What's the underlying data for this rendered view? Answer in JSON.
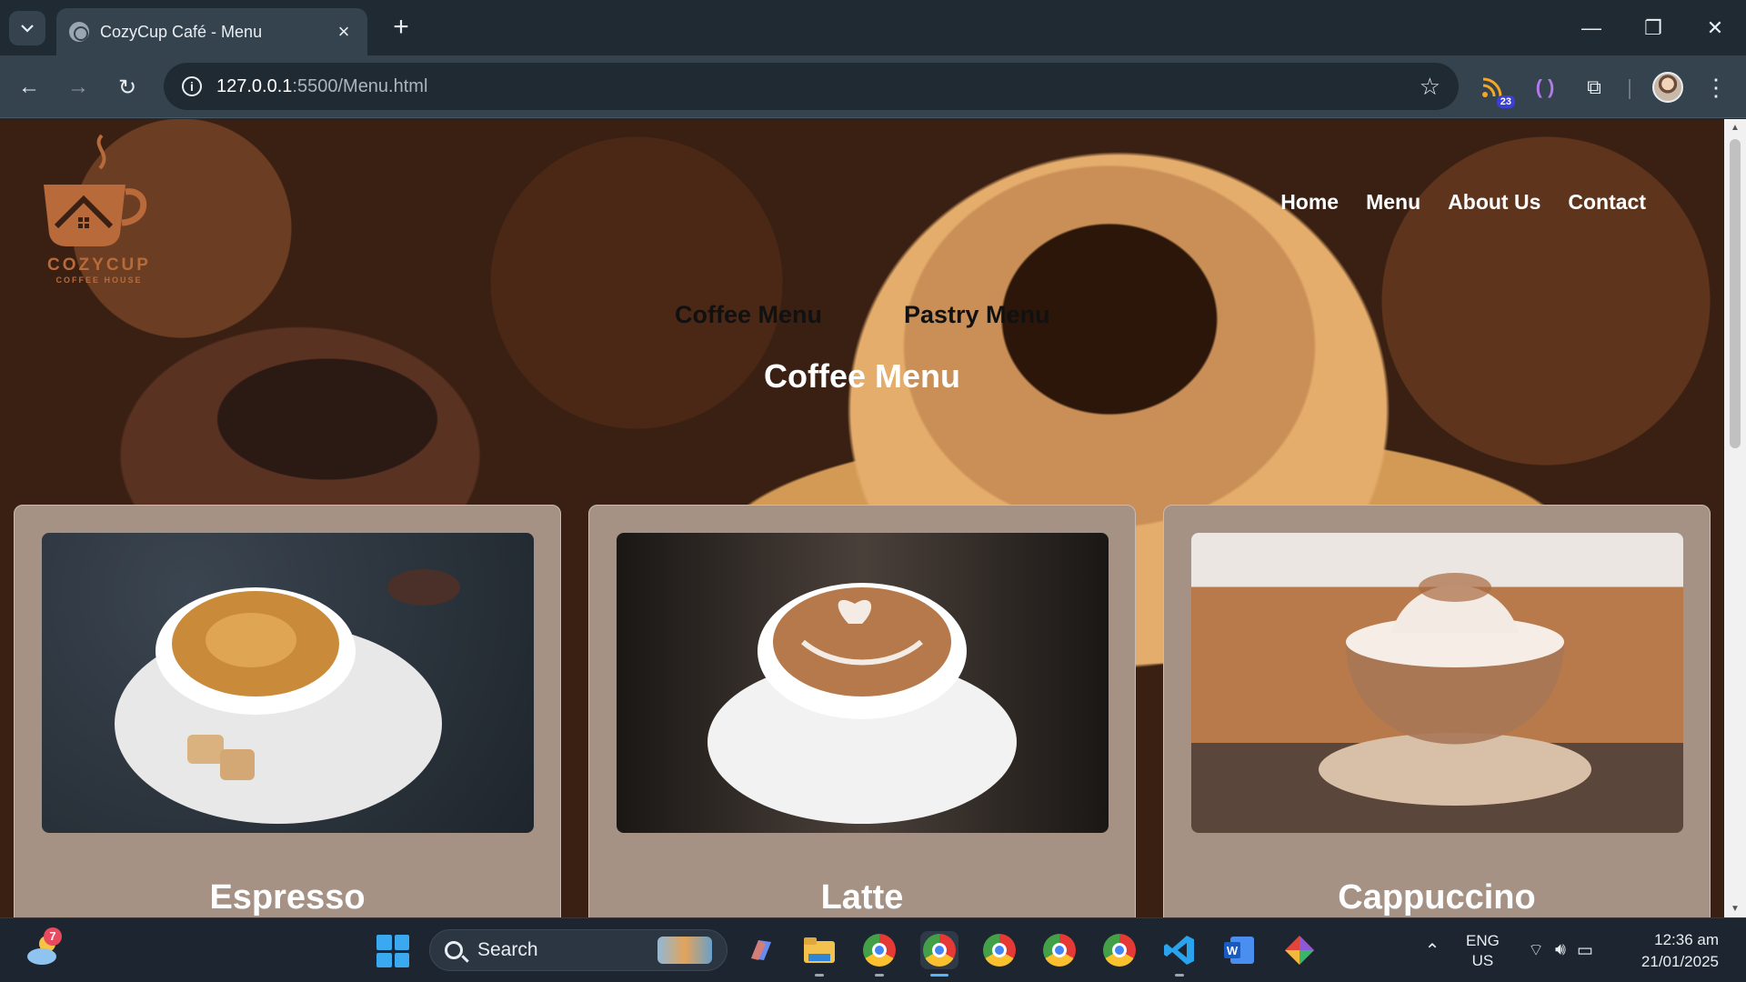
{
  "browser": {
    "tab_title": "CozyCup Café - Menu",
    "url_host": "127.0.0.1",
    "url_path": ":5500/Menu.html",
    "extension_badge": "23"
  },
  "site": {
    "logo_name": "COZYCUP",
    "logo_tagline": "COFFEE HOUSE",
    "nav": [
      "Home",
      "Menu",
      "About Us",
      "Contact"
    ],
    "menu_tabs": [
      "Coffee Menu",
      "Pastry Menu"
    ],
    "section_title": "Coffee Menu",
    "items": [
      {
        "name": "Espresso"
      },
      {
        "name": "Latte"
      },
      {
        "name": "Cappuccino"
      }
    ]
  },
  "taskbar": {
    "weather_badge": "7",
    "search_label": "Search",
    "language": "ENG",
    "region": "US",
    "time": "12:36 am",
    "date": "21/01/2025"
  },
  "colors": {
    "card_bg": "#a59285",
    "chrome_dark": "#1f2a33",
    "chrome_mid": "#34434e",
    "logo": "#b86a3a"
  }
}
